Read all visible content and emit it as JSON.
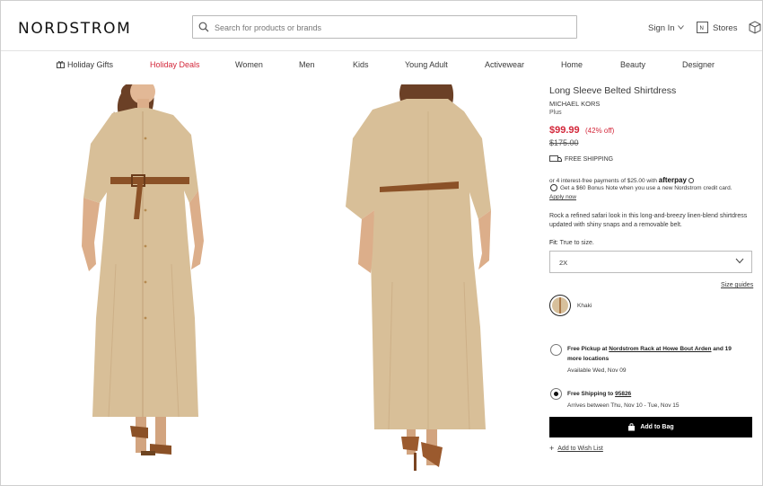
{
  "header": {
    "logo": "NORDSTROM",
    "search_placeholder": "Search for products or brands",
    "sign_in": "Sign In",
    "stores": "Stores"
  },
  "nav": {
    "items": [
      {
        "label": "Holiday Gifts"
      },
      {
        "label": "Holiday Deals"
      },
      {
        "label": "Women"
      },
      {
        "label": "Men"
      },
      {
        "label": "Kids"
      },
      {
        "label": "Young Adult"
      },
      {
        "label": "Activewear"
      },
      {
        "label": "Home"
      },
      {
        "label": "Beauty"
      },
      {
        "label": "Designer"
      }
    ],
    "accent_color": "#d3273a"
  },
  "product": {
    "title": "Long Sleeve Belted Shirtdress",
    "brand": "MICHAEL KORS",
    "fit_tag": "Plus",
    "price": "$99.99",
    "percent_off": "(42% off)",
    "original_price": "$175.00",
    "free_shipping": "FREE SHIPPING",
    "afterpay_text": "or 4 interest-free payments of $25.00 with",
    "afterpay_brand": "afterpay",
    "bonus_note": "Get a $60 Bonus Note when you use a new Nordstrom credit card.",
    "apply_now": "Apply now",
    "description": "Rock a refined safari look in this long-and-breezy linen-blend shirtdress updated with shiny snaps and a removable belt.",
    "fit_label": "Fit:",
    "fit_value": "True to size.",
    "size_selected": "2X",
    "size_guides": "Size guides",
    "color_name": "Khaki",
    "pickup": {
      "prefix": "Free Pickup at ",
      "store": "Nordstrom Rack at Howe Bout Arden",
      "suffix": " and 19",
      "line2": "more locations",
      "availability": "Available Wed, Nov 09"
    },
    "shipping": {
      "prefix": "Free Shipping to ",
      "zip": "95826",
      "arrival": "Arrives between Thu, Nov 10 - Tue, Nov 15"
    },
    "add_to_bag": "Add to Bag",
    "wish_list": "Add to Wish List"
  }
}
